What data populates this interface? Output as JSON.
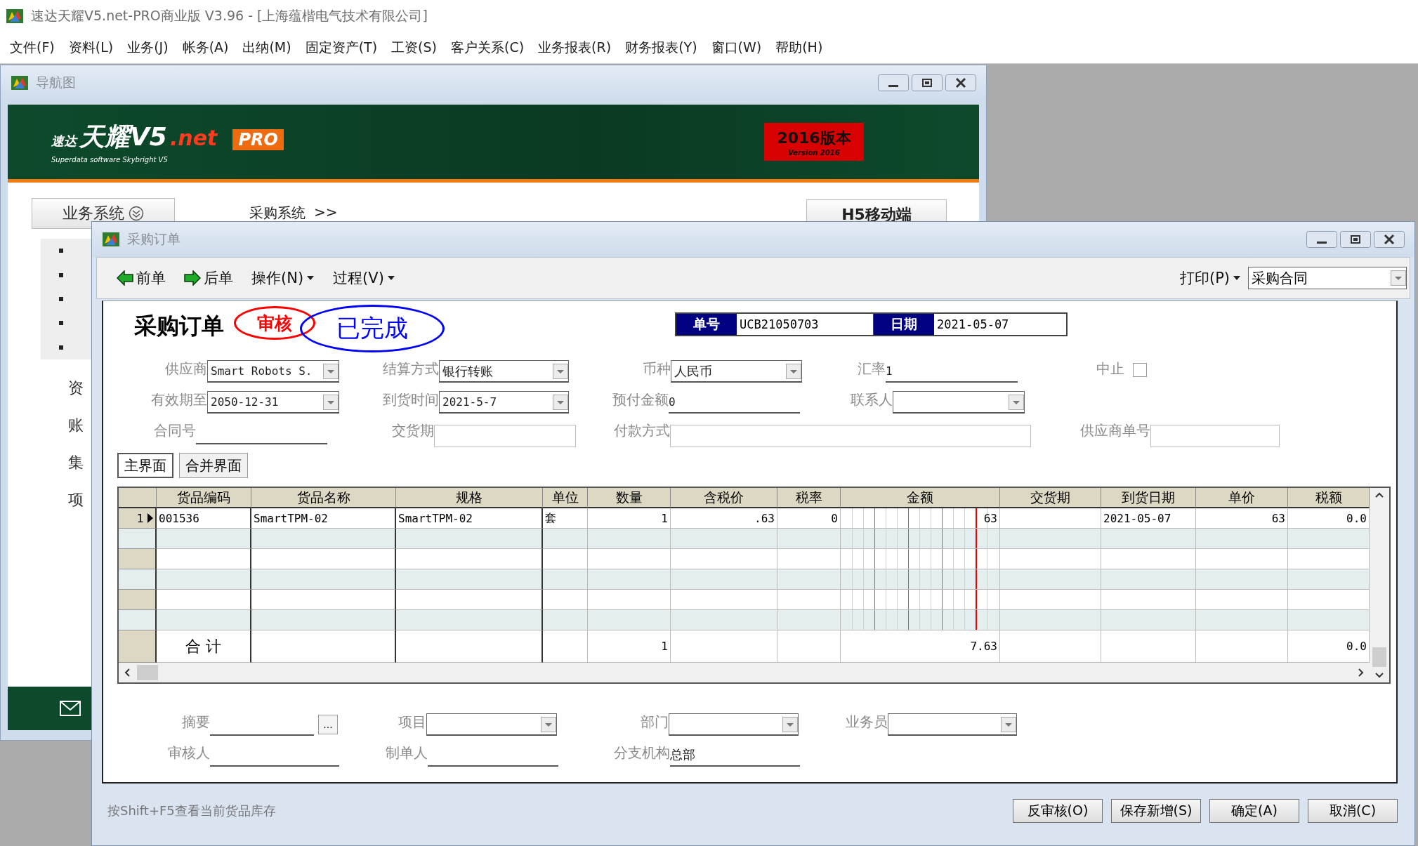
{
  "window": {
    "title": "速达天耀V5.net-PRO商业版 V3.96 - [上海蕴楷电气技术有限公司]"
  },
  "menu_bar": [
    "文件(F)",
    "资料(L)",
    "业务(J)",
    "帐务(A)",
    "出纳(M)",
    "固定资产(T)",
    "工资(S)",
    "客户关系(C)",
    "业务报表(R)",
    "财务报表(Y)",
    "窗口(W)",
    "帮助(H)"
  ],
  "nav_window": {
    "title": "导航图",
    "logo": {
      "small": "速达",
      "main": "天耀V5",
      "suffix": ".net",
      "badge": "PRO",
      "tagline": "Superdata software Skybright V5"
    },
    "version_badge": {
      "title": "2016版本",
      "subtitle": "Version 2016"
    },
    "section_tab": "业务系统",
    "breadcrumb": "采购系统",
    "breadcrumb_arrow": ">>",
    "mobile_button": "H5移动端",
    "side_items": [
      "资",
      "账",
      "集",
      "项"
    ]
  },
  "order_window": {
    "title": "采购订单",
    "toolbar": [
      {
        "kind": "back",
        "label": "前单"
      },
      {
        "kind": "forward",
        "label": "后单"
      },
      {
        "kind": "menu",
        "label": "操作(N)"
      },
      {
        "kind": "menu",
        "label": "过程(V)"
      }
    ],
    "print": {
      "label": "打印(P)",
      "template": "采购合同"
    },
    "heading": "采购订单",
    "stamps": [
      {
        "text": "审核",
        "color": "#ff0000"
      },
      {
        "text": "已完成",
        "color": "#0000ff"
      }
    ],
    "doc_number": {
      "label": "单号",
      "value": "UCB21050703"
    },
    "doc_date": {
      "label": "日期",
      "value": "2021-05-07"
    },
    "fields": [
      [
        {
          "label": "供应商",
          "kind": "combo",
          "value": "Smart Robots S."
        },
        {
          "label": "结算方式",
          "kind": "combo",
          "value": "银行转账"
        },
        {
          "label": "币种",
          "kind": "combo",
          "value": "人民币"
        },
        {
          "label": "汇率",
          "kind": "line",
          "value": "1"
        },
        {
          "label": "中止",
          "kind": "checkbox",
          "checked": false
        }
      ],
      [
        {
          "label": "有效期至",
          "kind": "combo",
          "value": "2050-12-31"
        },
        {
          "label": "到货时间",
          "kind": "combo",
          "value": "2021-5-7"
        },
        {
          "label": "预付金额",
          "kind": "line",
          "value": "0"
        },
        {
          "label": "联系人",
          "kind": "combo"
        }
      ],
      [
        {
          "label": "合同号",
          "kind": "line"
        },
        {
          "label": "交货期",
          "kind": "box"
        },
        {
          "label": "付款方式",
          "kind": "box"
        },
        {
          "label": "供应商单号",
          "kind": "box"
        }
      ]
    ],
    "tabs": [
      {
        "label": "主界面",
        "selected": true
      },
      {
        "label": "合并界面",
        "selected": false
      }
    ],
    "grid": {
      "columns": [
        "货品编码",
        "货品名称",
        "规格",
        "单位",
        "数量",
        "含税价",
        "税率",
        "金额",
        "交货期",
        "到货日期",
        "单价",
        "税额"
      ],
      "rows": [
        {
          "number": "1",
          "current": true,
          "cells": [
            "001536",
            "SmartTPM-02",
            "SmartTPM-02",
            "套",
            "1",
            ".63",
            "0",
            "63",
            null,
            "2021-05-07",
            "63",
            "0.0"
          ]
        }
      ],
      "totals": {
        "label": "合 计",
        "cells": [
          null,
          null,
          null,
          "1",
          null,
          null,
          "7.63",
          null,
          null,
          null,
          "0.0"
        ]
      }
    },
    "footer_fields": [
      [
        {
          "label": "摘要",
          "kind": "memo",
          "button": "..."
        },
        {
          "label": "项目",
          "kind": "combo"
        },
        {
          "label": "部门",
          "kind": "combo"
        },
        {
          "label": "业务员",
          "kind": "combo"
        }
      ],
      [
        {
          "label": "审核人",
          "kind": "line"
        },
        {
          "label": "制单人",
          "kind": "line"
        },
        {
          "label": "分支机构",
          "kind": "line",
          "value": "总部"
        }
      ]
    ],
    "hint": "按Shift+F5查看当前货品库存",
    "buttons": [
      "反审核(O)",
      "保存新增(S)",
      "确定(A)",
      "取消(C)"
    ]
  }
}
